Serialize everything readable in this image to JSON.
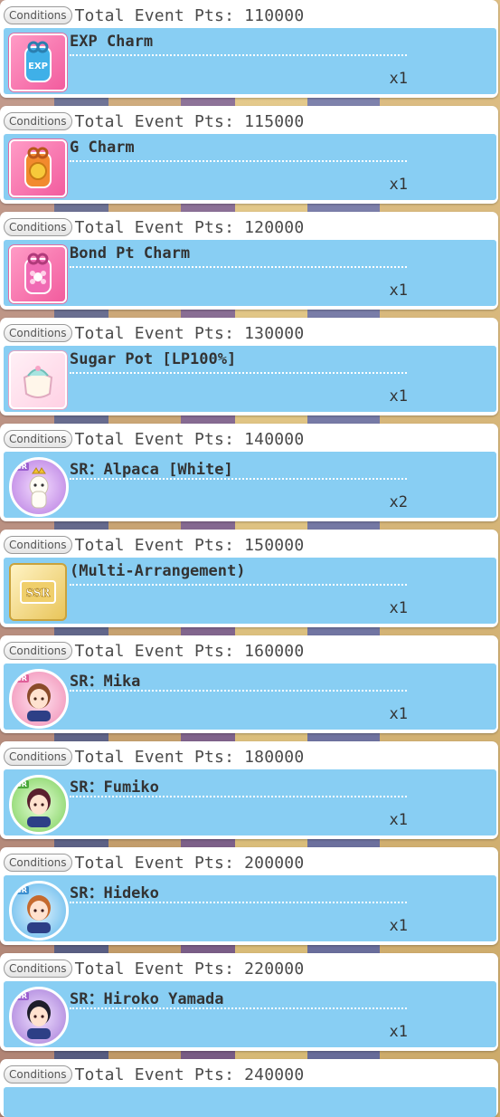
{
  "condition_label": "Conditions",
  "rewards": [
    {
      "condition": "Total Event Pts: 110000",
      "name": "EXP Charm",
      "qty": "x1",
      "icon": "exp-charm",
      "icon_text": "EXP"
    },
    {
      "condition": "Total Event Pts: 115000",
      "name": "G Charm",
      "qty": "x1",
      "icon": "g-charm"
    },
    {
      "condition": "Total Event Pts: 120000",
      "name": "Bond Pt Charm",
      "qty": "x1",
      "icon": "bond-pt-charm"
    },
    {
      "condition": "Total Event Pts: 130000",
      "name": "Sugar Pot [LP100%]",
      "qty": "x1",
      "icon": "sugar-pot"
    },
    {
      "condition": "Total Event Pts: 140000",
      "name": "SR：Alpaca [White]",
      "qty": "x2",
      "icon": "alpaca-card",
      "rarity": "SR"
    },
    {
      "condition": "Total Event Pts: 150000",
      "name": "(Multi-Arrangement)",
      "qty": "x1",
      "icon": "ssr-ticket",
      "icon_text": "SSR"
    },
    {
      "condition": "Total Event Pts: 160000",
      "name": "SR：Mika",
      "qty": "x1",
      "icon": "mika-card",
      "rarity": "SR"
    },
    {
      "condition": "Total Event Pts: 180000",
      "name": "SR：Fumiko",
      "qty": "x1",
      "icon": "fumiko-card",
      "rarity": "SR"
    },
    {
      "condition": "Total Event Pts: 200000",
      "name": "SR：Hideko",
      "qty": "x1",
      "icon": "hideko-card",
      "rarity": "SR"
    },
    {
      "condition": "Total Event Pts: 220000",
      "name": "SR：Hiroko Yamada",
      "qty": "x1",
      "icon": "hiroko-card",
      "rarity": "SR"
    },
    {
      "condition": "Total Event Pts: 240000"
    }
  ]
}
